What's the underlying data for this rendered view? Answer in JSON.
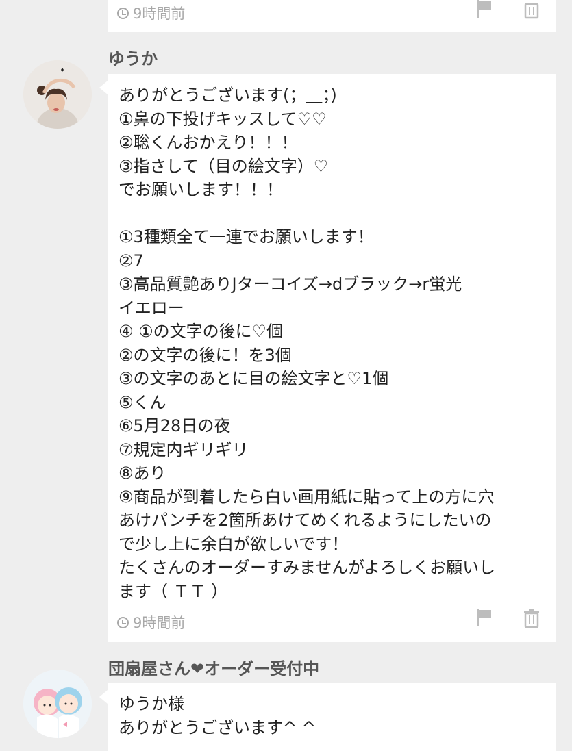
{
  "top_comment": {
    "time": "9時間前"
  },
  "comment1": {
    "author": "ゆうか",
    "lines": [
      "ありがとうございます(；＿；)",
      "①鼻の下投げキッスして♡♡",
      "②聡くんおかえり！！！",
      "③指さして（目の絵文字）♡",
      "でお願いします！！！",
      "",
      "①3種類全て一連でお願いします！",
      "②7",
      "③高品質艶ありJターコイズ→dブラック→r蛍光",
      "イエロー",
      "④ ①の文字の後に♡個",
      "②の文字の後に！を3個",
      "③の文字のあとに目の絵文字と♡1個",
      "⑤くん",
      "⑥5月28日の夜",
      "⑦規定内ギリギリ",
      "⑧あり",
      "⑨商品が到着したら白い画用紙に貼って上の方に穴",
      "あけパンチを2箇所あけてめくれるようにしたいの",
      "で少し上に余白が欲しいです！",
      "たくさんのオーダーすみませんがよろしくお願いし",
      "ます（ ＴＴ ）"
    ],
    "time": "9時間前"
  },
  "comment2": {
    "author": "団扇屋さん❤︎オーダー受付中",
    "lines": [
      "ゆうか様",
      "ありがとうございます^ ^"
    ]
  },
  "icons": {
    "clock": "clock-icon",
    "flag": "flag-icon",
    "trash": "trash-icon"
  }
}
